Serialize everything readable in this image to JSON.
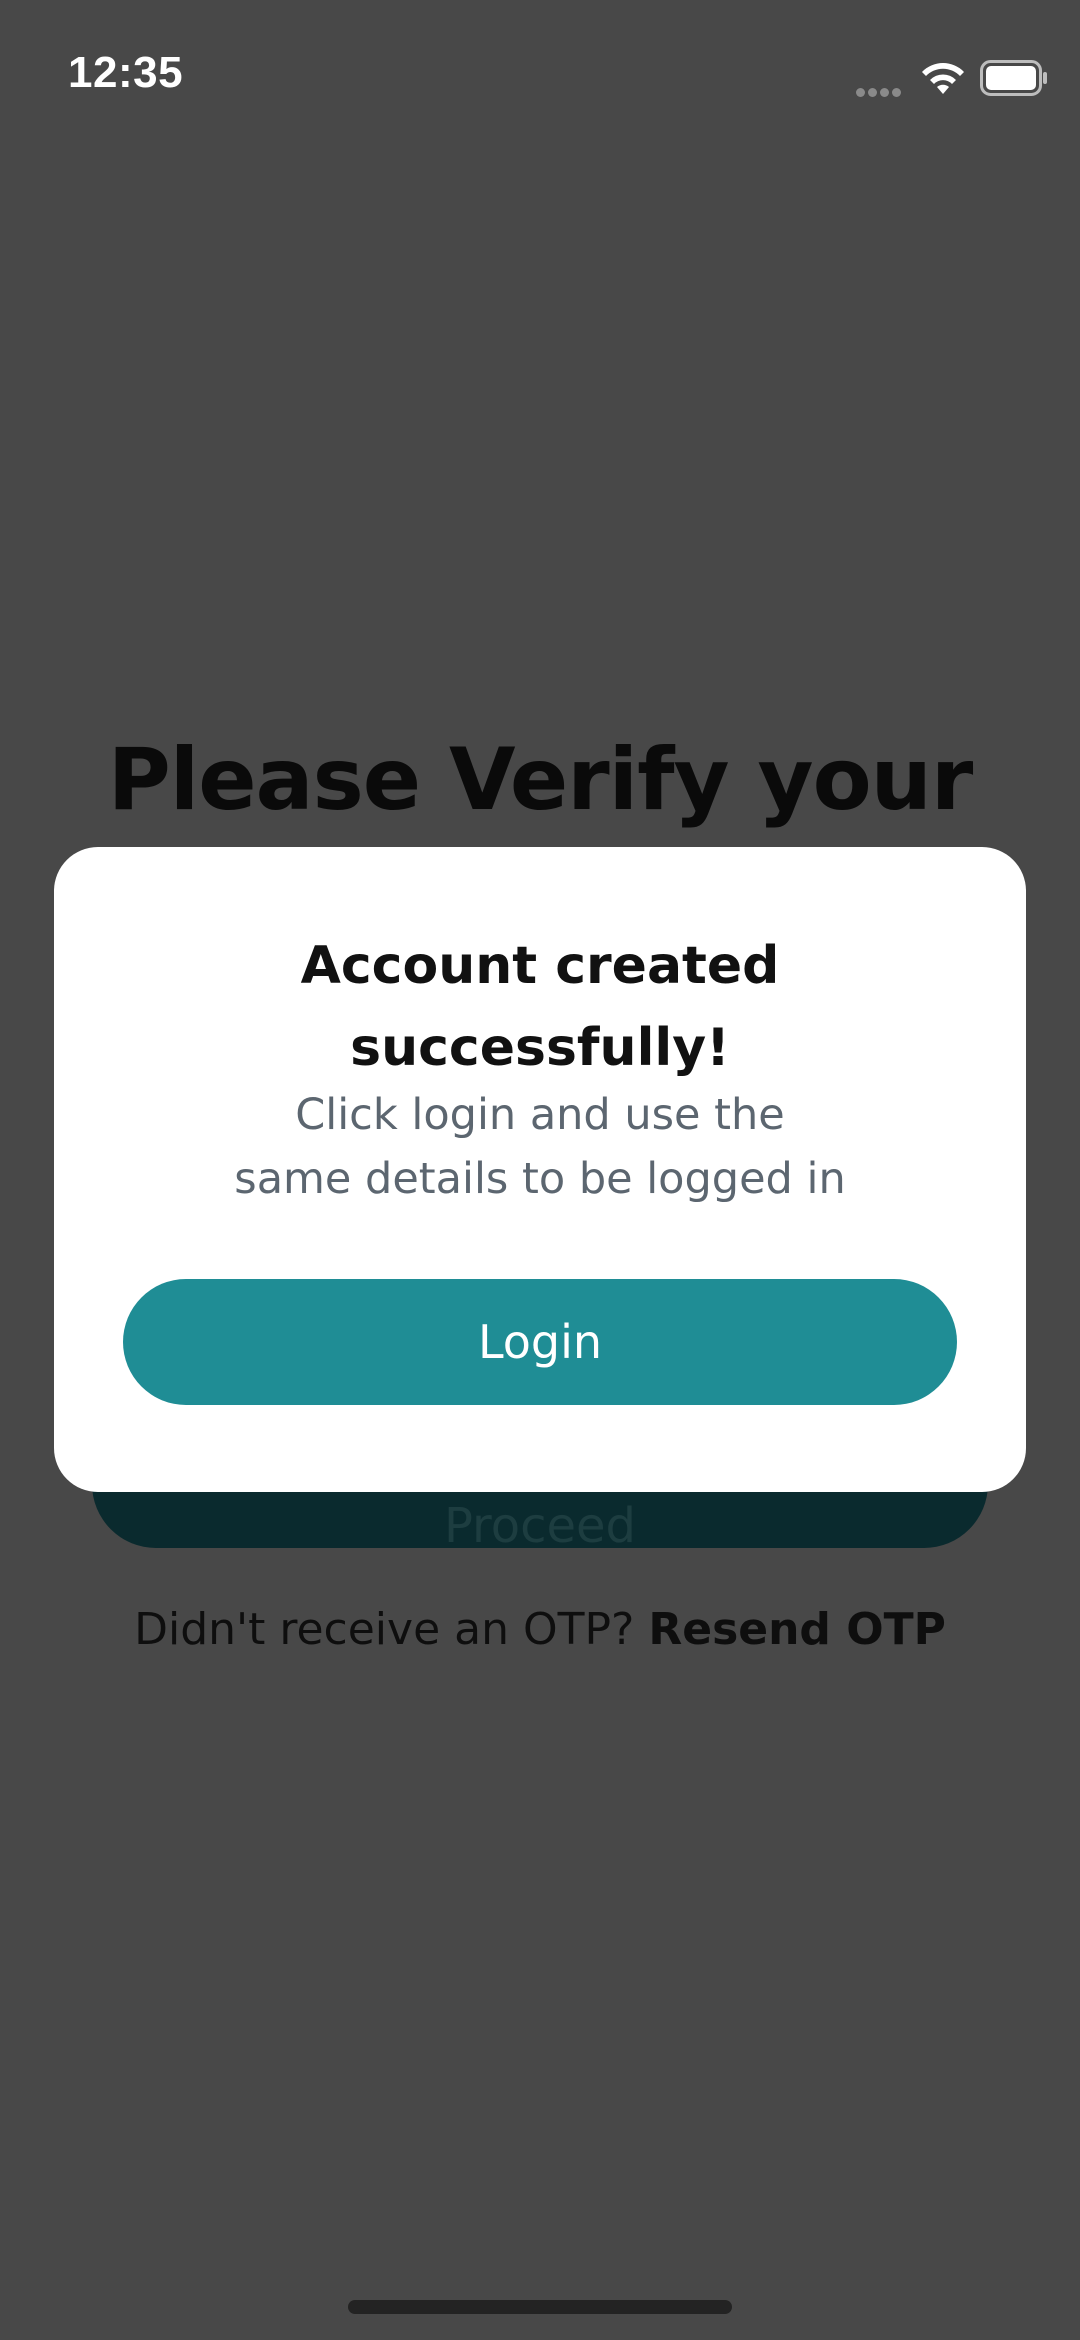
{
  "status_bar": {
    "time": "12:35"
  },
  "background": {
    "title": "Please Verify your",
    "proceed_label": "Proceed",
    "resend_prompt": "Didn't receive an OTP? ",
    "resend_link": "Resend OTP"
  },
  "modal": {
    "title_line1": "Account created",
    "title_line2": "successfully!",
    "message_line1": "Click login and use the",
    "message_line2": "same details to be logged in",
    "login_label": "Login"
  },
  "colors": {
    "overlay": "#484848",
    "accent": "#1f8d95",
    "modal_bg": "#ffffff",
    "message_text": "#5c6670"
  },
  "icons": [
    "signal-icon",
    "wifi-icon",
    "battery-icon"
  ]
}
